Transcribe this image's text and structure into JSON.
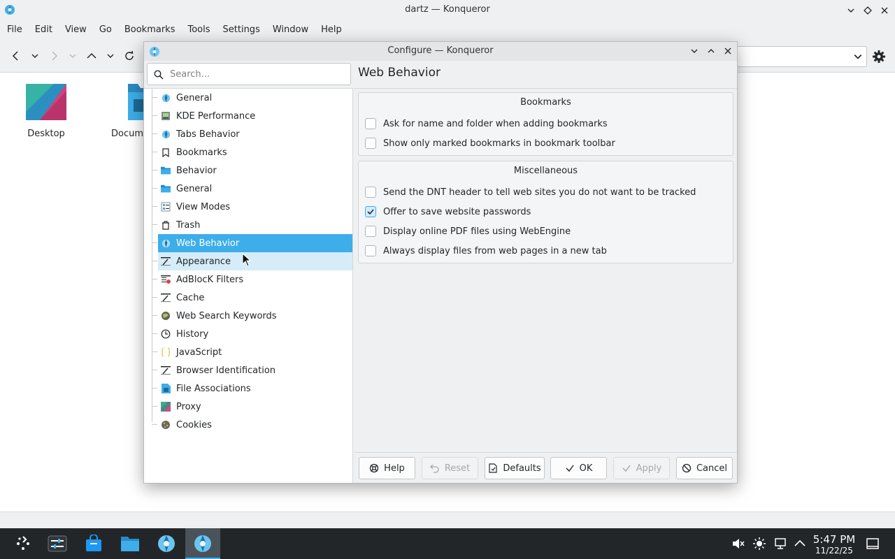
{
  "window": {
    "title": "dartz — Konqueror",
    "menu": [
      "File",
      "Edit",
      "View",
      "Go",
      "Bookmarks",
      "Tools",
      "Settings",
      "Window",
      "Help"
    ]
  },
  "desktop_items": [
    {
      "label": "Desktop",
      "icon": "desktop-folder-icon"
    },
    {
      "label": "Docum",
      "icon": "documents-folder-icon"
    }
  ],
  "dialog": {
    "title": "Configure — Konqueror",
    "search_placeholder": "Search...",
    "nav_items": [
      {
        "label": "General",
        "icon": "konqueror-icon"
      },
      {
        "label": "KDE Performance",
        "icon": "performance-icon"
      },
      {
        "label": "Tabs Behavior",
        "icon": "konqueror-icon"
      },
      {
        "label": "Bookmarks",
        "icon": "bookmark-icon"
      },
      {
        "label": "Behavior",
        "icon": "folder-icon"
      },
      {
        "label": "General",
        "icon": "folder-icon"
      },
      {
        "label": "View Modes",
        "icon": "view-modes-icon"
      },
      {
        "label": "Trash",
        "icon": "trash-icon"
      },
      {
        "label": "Web Behavior",
        "icon": "konqueror-icon"
      },
      {
        "label": "Appearance",
        "icon": "appearance-icon"
      },
      {
        "label": "AdBlocK Filters",
        "icon": "adblock-icon"
      },
      {
        "label": "Cache",
        "icon": "cache-icon"
      },
      {
        "label": "Web Search Keywords",
        "icon": "web-search-icon"
      },
      {
        "label": "History",
        "icon": "history-icon"
      },
      {
        "label": "JavaScript",
        "icon": "javascript-icon"
      },
      {
        "label": "Browser Identification",
        "icon": "browser-id-icon"
      },
      {
        "label": "File Associations",
        "icon": "file-associations-icon"
      },
      {
        "label": "Proxy",
        "icon": "proxy-icon"
      },
      {
        "label": "Cookies",
        "icon": "cookies-icon"
      }
    ],
    "selected_item": "Web Behavior",
    "hovered_item": "Appearance",
    "panel_title": "Web Behavior",
    "groups": [
      {
        "title": "Bookmarks",
        "options": [
          {
            "label": "Ask for name and folder when adding bookmarks",
            "checked": false
          },
          {
            "label": "Show only marked bookmarks in bookmark toolbar",
            "checked": false
          }
        ]
      },
      {
        "title": "Miscellaneous",
        "options": [
          {
            "label": "Send the DNT header to tell web sites you do not want to be tracked",
            "checked": false
          },
          {
            "label": "Offer to save website passwords",
            "checked": true
          },
          {
            "label": "Display online PDF files using WebEngine",
            "checked": false
          },
          {
            "label": "Always display files from web pages in a new tab",
            "checked": false
          }
        ]
      }
    ],
    "buttons": [
      {
        "label": "Help",
        "icon": "help-icon",
        "enabled": true
      },
      {
        "label": "Reset",
        "icon": "undo-icon",
        "enabled": false
      },
      {
        "label": "Defaults",
        "icon": "document-icon",
        "enabled": true
      },
      {
        "label": "OK",
        "icon": "checkmark-icon",
        "enabled": true
      },
      {
        "label": "Apply",
        "icon": "checkmark-icon",
        "enabled": false
      },
      {
        "label": "Cancel",
        "icon": "cancel-icon",
        "enabled": true
      }
    ]
  },
  "taskbar": {
    "time": "5:47 PM",
    "date": "11/22/25"
  },
  "colors": {
    "accent": "#3daee9",
    "hover": "#d6ecf8",
    "taskbar": "#232629"
  }
}
